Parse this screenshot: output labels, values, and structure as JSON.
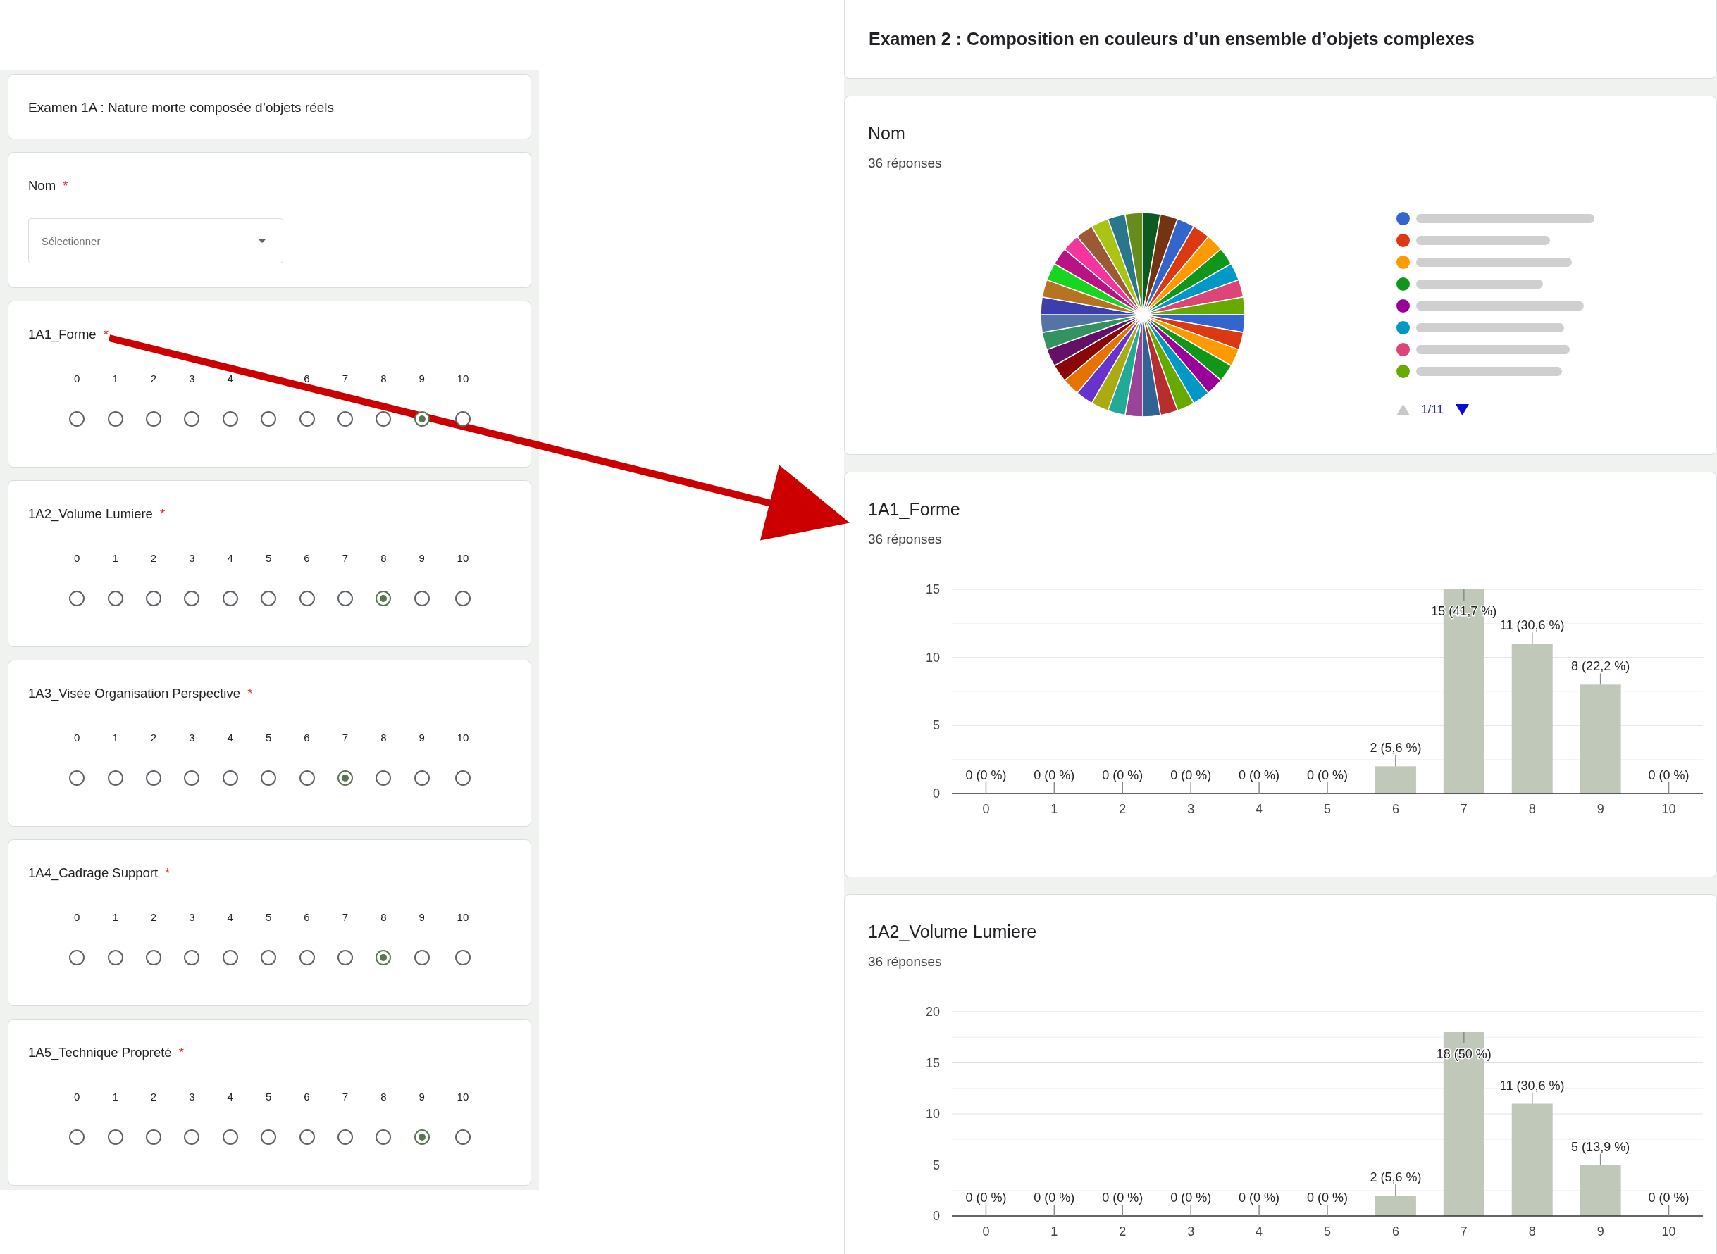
{
  "form": {
    "title": "Examen 1A : Nature morte composée d’objets réels",
    "questions": [
      {
        "kind": "dropdown",
        "title": "Nom",
        "required_mark": "*",
        "placeholder": "Sélectionner"
      },
      {
        "kind": "scale",
        "title": "1A1_Forme",
        "required_mark": "*",
        "options": [
          {
            "label": "0",
            "selected": false
          },
          {
            "label": "1",
            "selected": false
          },
          {
            "label": "2",
            "selected": false
          },
          {
            "label": "3",
            "selected": false
          },
          {
            "label": "4",
            "selected": false
          },
          {
            "selected": false
          },
          {
            "label": "6",
            "selected": false
          },
          {
            "label": "7",
            "selected": false
          },
          {
            "label": "8",
            "selected": false
          },
          {
            "label": "9",
            "selected": true
          },
          {
            "label": "10",
            "selected": false
          }
        ]
      },
      {
        "kind": "scale",
        "title": "1A2_Volume Lumiere",
        "required_mark": "*",
        "options": [
          {
            "label": "0",
            "selected": false
          },
          {
            "label": "1",
            "selected": false
          },
          {
            "label": "2",
            "selected": false
          },
          {
            "label": "3",
            "selected": false
          },
          {
            "label": "4",
            "selected": false
          },
          {
            "label": "5",
            "selected": false
          },
          {
            "label": "6",
            "selected": false
          },
          {
            "label": "7",
            "selected": false
          },
          {
            "label": "8",
            "selected": true
          },
          {
            "label": "9",
            "selected": false
          },
          {
            "label": "10",
            "selected": false
          }
        ]
      },
      {
        "kind": "scale",
        "title": "1A3_Visée Organisation Perspective",
        "required_mark": "*",
        "options": [
          {
            "label": "0",
            "selected": false
          },
          {
            "label": "1",
            "selected": false
          },
          {
            "label": "2",
            "selected": false
          },
          {
            "label": "3",
            "selected": false
          },
          {
            "label": "4",
            "selected": false
          },
          {
            "label": "5",
            "selected": false
          },
          {
            "label": "6",
            "selected": false
          },
          {
            "label": "7",
            "selected": true
          },
          {
            "label": "8",
            "selected": false
          },
          {
            "label": "9",
            "selected": false
          },
          {
            "label": "10",
            "selected": false
          }
        ]
      },
      {
        "kind": "scale",
        "title": "1A4_Cadrage Support",
        "required_mark": "*",
        "options": [
          {
            "label": "0",
            "selected": false
          },
          {
            "label": "1",
            "selected": false
          },
          {
            "label": "2",
            "selected": false
          },
          {
            "label": "3",
            "selected": false
          },
          {
            "label": "4",
            "selected": false
          },
          {
            "label": "5",
            "selected": false
          },
          {
            "label": "6",
            "selected": false
          },
          {
            "label": "7",
            "selected": false
          },
          {
            "label": "8",
            "selected": true
          },
          {
            "label": "9",
            "selected": false
          },
          {
            "label": "10",
            "selected": false
          }
        ]
      },
      {
        "kind": "scale",
        "title": "1A5_Technique Propreté",
        "required_mark": "*",
        "options": [
          {
            "label": "0",
            "selected": false
          },
          {
            "label": "1",
            "selected": false
          },
          {
            "label": "2",
            "selected": false
          },
          {
            "label": "3",
            "selected": false
          },
          {
            "label": "4",
            "selected": false
          },
          {
            "label": "5",
            "selected": false
          },
          {
            "label": "6",
            "selected": false
          },
          {
            "label": "7",
            "selected": false
          },
          {
            "label": "8",
            "selected": false
          },
          {
            "label": "9",
            "selected": true
          },
          {
            "label": "10",
            "selected": false
          }
        ]
      }
    ]
  },
  "summary": {
    "title": "Examen 2 : Composition en couleurs d’un ensemble d’objets complexes",
    "questions": [
      {
        "kind": "pie",
        "title": "Nom",
        "responses": "36 réponses",
        "legend": [
          {
            "color": "#3366cc",
            "label_blurred": true
          },
          {
            "color": "#dc3912",
            "label_blurred": true
          },
          {
            "color": "#ff9900",
            "label_blurred": true
          },
          {
            "color": "#109618",
            "label_blurred": true
          },
          {
            "color": "#990099",
            "label_blurred": true
          },
          {
            "color": "#0099c6",
            "label_blurred": true
          },
          {
            "color": "#dd4477",
            "label_blurred": true
          },
          {
            "color": "#66aa00",
            "label_blurred": true
          }
        ],
        "pager": {
          "label": "1/11",
          "previous_disabled": true,
          "next_disabled": false
        }
      },
      {
        "kind": "chart",
        "title": "1A1_Forme",
        "responses": "36 réponses",
        "chart_data": {
          "type": "bar",
          "categories": [
            "0",
            "1",
            "2",
            "3",
            "4",
            "5",
            "6",
            "7",
            "8",
            "9",
            "10"
          ],
          "values": [
            0,
            0,
            0,
            0,
            0,
            0,
            2,
            15,
            11,
            8,
            0
          ],
          "ylim": [
            0,
            15
          ],
          "yticks": [
            0,
            5,
            10,
            15
          ],
          "grid": true,
          "value_labels": [
            "0 (0 %)",
            "0 (0 %)",
            "0 (0 %)",
            "0 (0 %)",
            "0 (0 %)",
            "0 (0 %)",
            "2 (5,6 %)",
            "15 (41,7 %)",
            "11 (30,6 %)",
            "8 (22,2 %)",
            "0 (0 %)"
          ]
        }
      },
      {
        "kind": "chart",
        "title": "1A2_Volume Lumiere",
        "responses": "36 réponses",
        "chart_data": {
          "type": "bar",
          "categories": [
            "0",
            "1",
            "2",
            "3",
            "4",
            "5",
            "6",
            "7",
            "8",
            "9",
            "10"
          ],
          "values": [
            0,
            0,
            0,
            0,
            0,
            0,
            2,
            18,
            11,
            5,
            0
          ],
          "ylim": [
            0,
            20
          ],
          "yticks": [
            0,
            5,
            10,
            15,
            20
          ],
          "grid": true,
          "value_labels": [
            "0 (0 %)",
            "0 (0 %)",
            "0 (0 %)",
            "0 (0 %)",
            "0 (0 %)",
            "0 (0 %)",
            "2 (5,6 %)",
            "18 (50 %)",
            "11 (30,6 %)",
            "5 (13,9 %)",
            "0 (0 %)"
          ]
        }
      }
    ]
  },
  "annotations": [
    {
      "kind": "arrow"
    }
  ]
}
